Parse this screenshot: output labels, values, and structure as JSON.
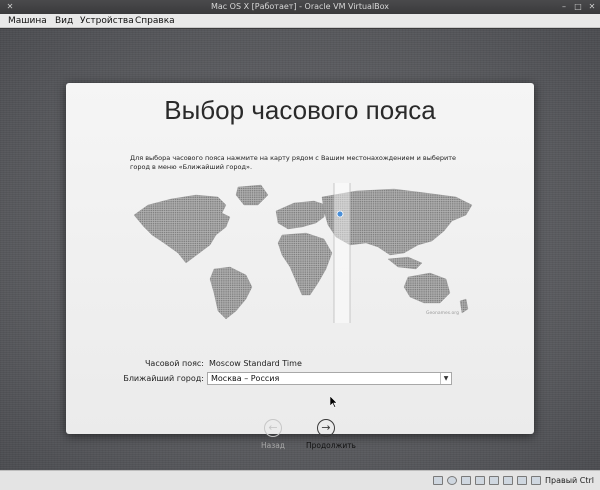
{
  "window": {
    "title": "Mac OS X [Работает] - Oracle VM VirtualBox"
  },
  "menu": {
    "items": [
      "Машина",
      "Вид",
      "Устройства",
      "Справка"
    ]
  },
  "dialog": {
    "title": "Выбор часового пояса",
    "instruction": "Для выбора часового пояса нажмите на карту рядом с Вашим местонахождением и выберите город в меню «Ближайший город».",
    "map_credit": "Geonames.org",
    "timezone_label": "Часовой пояс:",
    "timezone_value": "Moscow Standard Time",
    "city_label": "Ближайший город:",
    "city_value": "Москва – Россия",
    "back_label": "Назад",
    "next_label": "Продолжить",
    "back_icon": "←",
    "next_icon": "→"
  },
  "status": {
    "host_key": "Правый Ctrl"
  },
  "colors": {
    "dialog_bg": "#f0f0f0",
    "pin": "#4a8fd8",
    "map_land": "#9a9a9a"
  },
  "icons": [
    "minimize-icon",
    "maximize-icon",
    "close-icon",
    "location-pin-icon",
    "arrow-left-icon",
    "arrow-right-icon",
    "hdd-icon",
    "optical-icon",
    "usb-icon",
    "network-icon",
    "shared-folder-icon",
    "display-icon",
    "mouse-icon",
    "keyboard-icon"
  ]
}
